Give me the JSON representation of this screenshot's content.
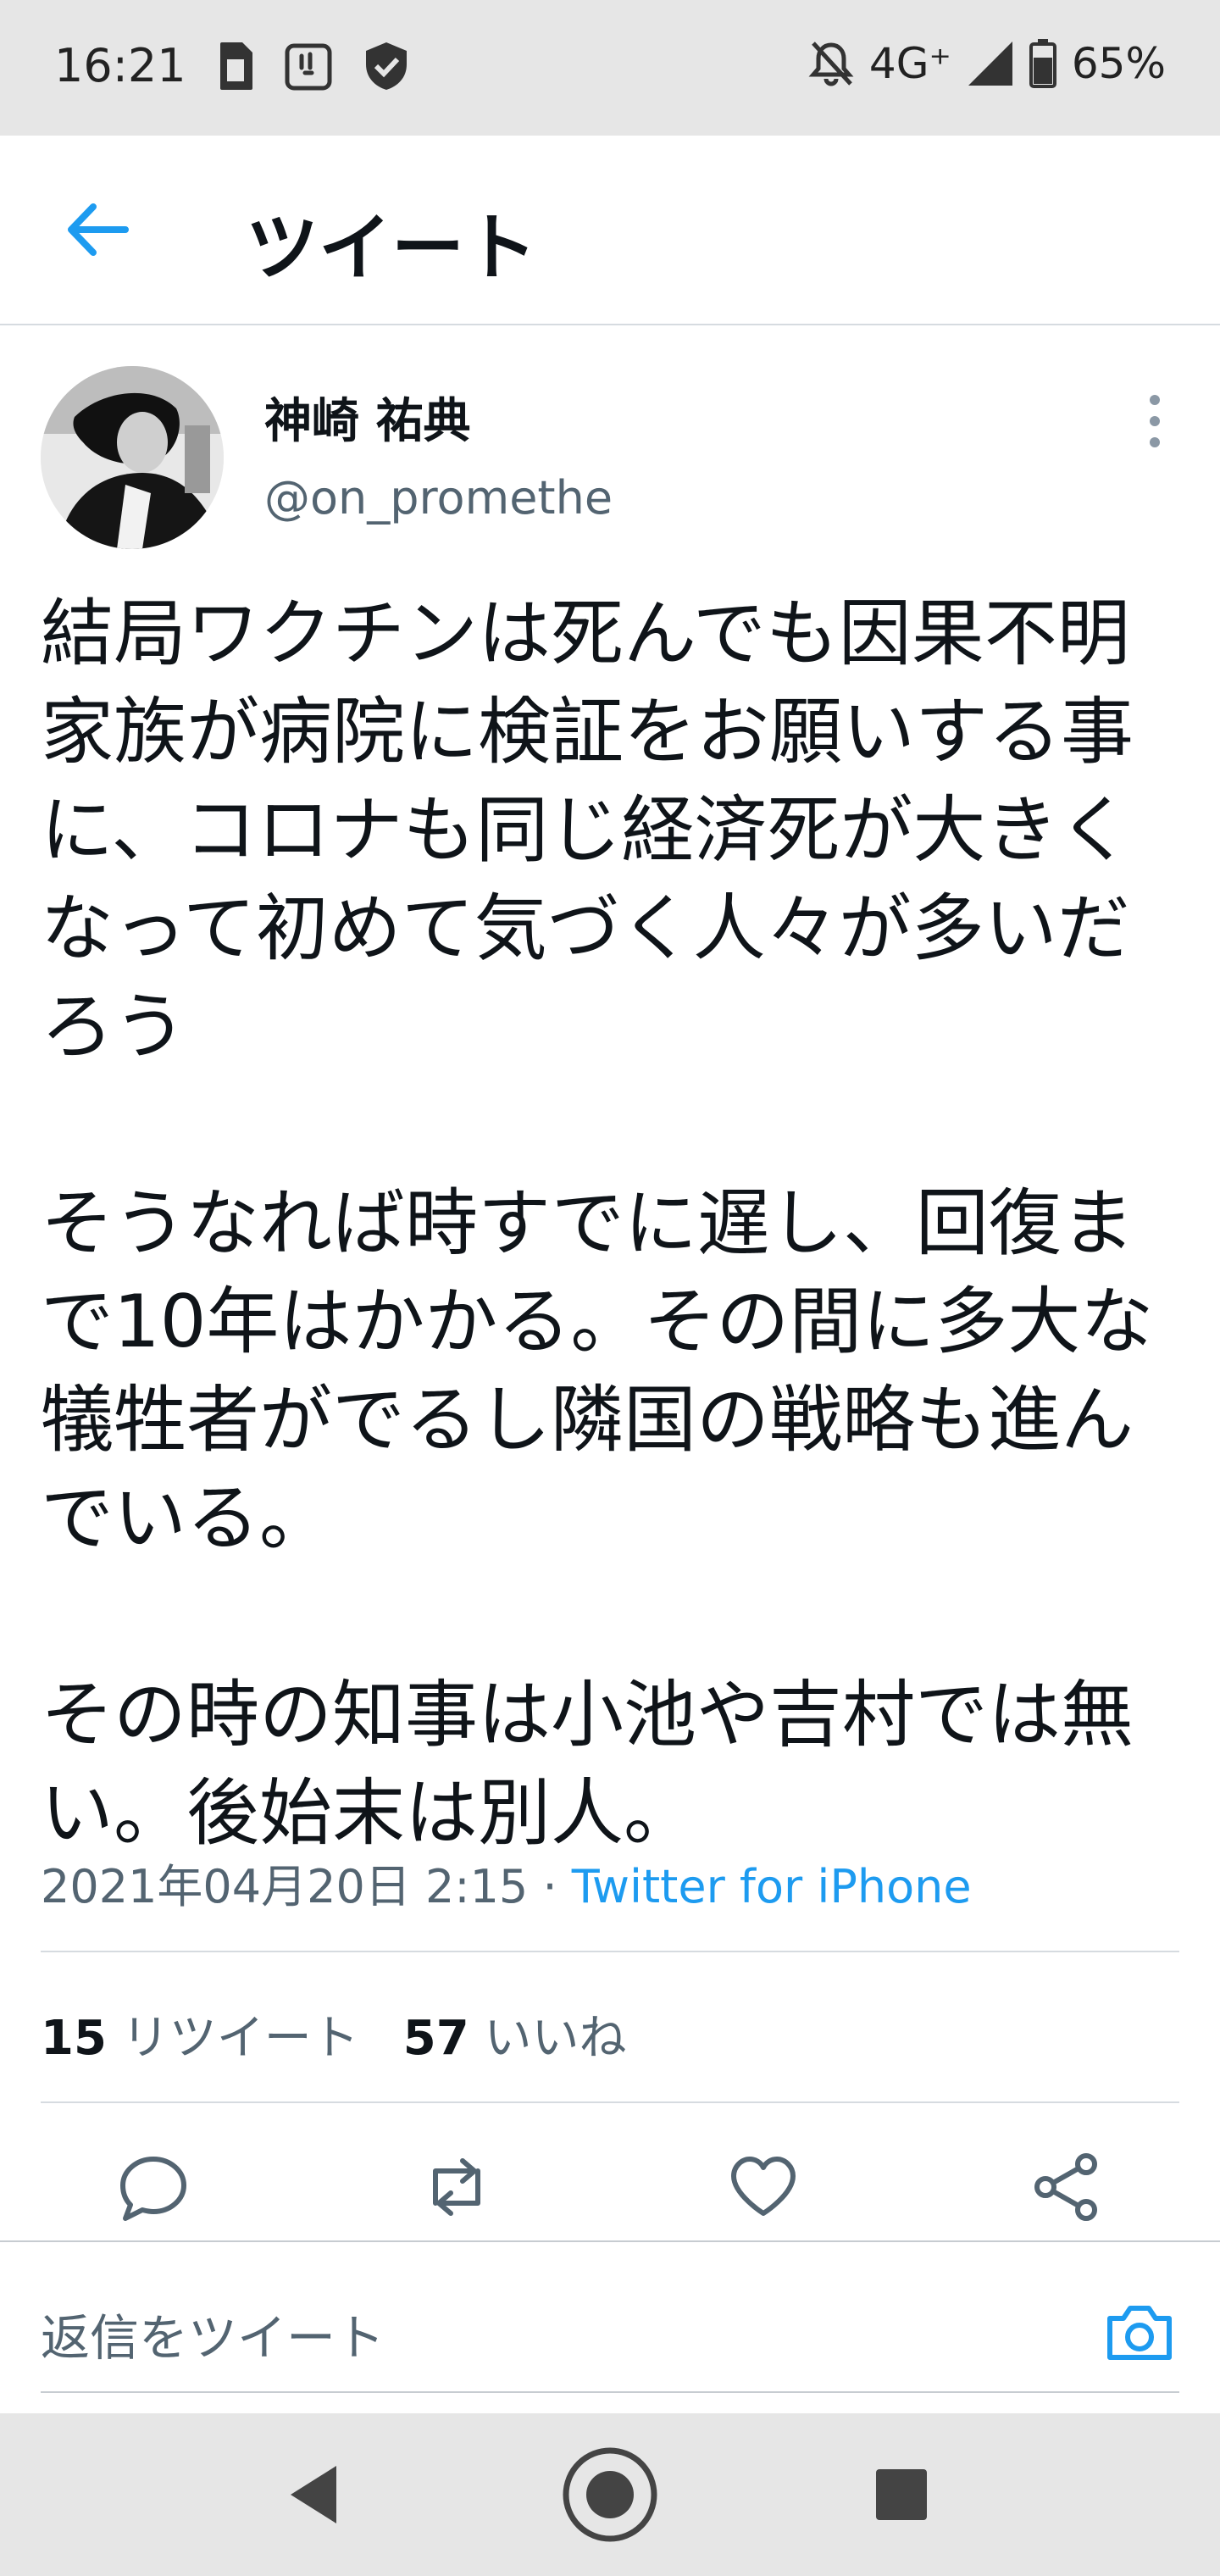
{
  "status_bar": {
    "time": "16:21",
    "network": "4G⁺",
    "battery": "65%",
    "left_icons": [
      "sim-card-icon",
      "notification-app-icon",
      "shield-check-icon"
    ],
    "right_icons": [
      "bell-off-icon",
      "signal-icon",
      "battery-icon"
    ]
  },
  "header": {
    "title": "ツイート",
    "back_icon": "back-arrow-icon"
  },
  "tweet": {
    "author_name": "神崎 祐典",
    "author_handle": "@on_promethe",
    "body": "結局ワクチンは死んでも因果不明家族が病院に検証をお願いする事に、コロナも同じ経済死が大きくなって初めて気づく人々が多いだろう\n\nそうなれば時すでに遅し、回復まで10年はかかる。その間に多大な犠牲者がでるし隣国の戦略も進んでいる。\n\nその時の知事は小池や吉村では無い。後始末は別人。",
    "date": "2021年04月20日 2:15",
    "separator": " · ",
    "source": "Twitter for iPhone",
    "retweet_count": "15",
    "retweet_label": "リツイート",
    "like_count": "57",
    "like_label": "いいね"
  },
  "actions": [
    "reply-icon",
    "retweet-icon",
    "like-icon",
    "share-icon"
  ],
  "reply_bar": {
    "placeholder": "返信をツイート",
    "camera_icon": "camera-icon"
  },
  "nav_bar": [
    "back-triangle-icon",
    "home-circle-icon",
    "recents-square-icon"
  ],
  "colors": {
    "accent": "#1d9bf0",
    "secondary_text": "#536471",
    "status_bar_bg": "#e6e6e6"
  }
}
